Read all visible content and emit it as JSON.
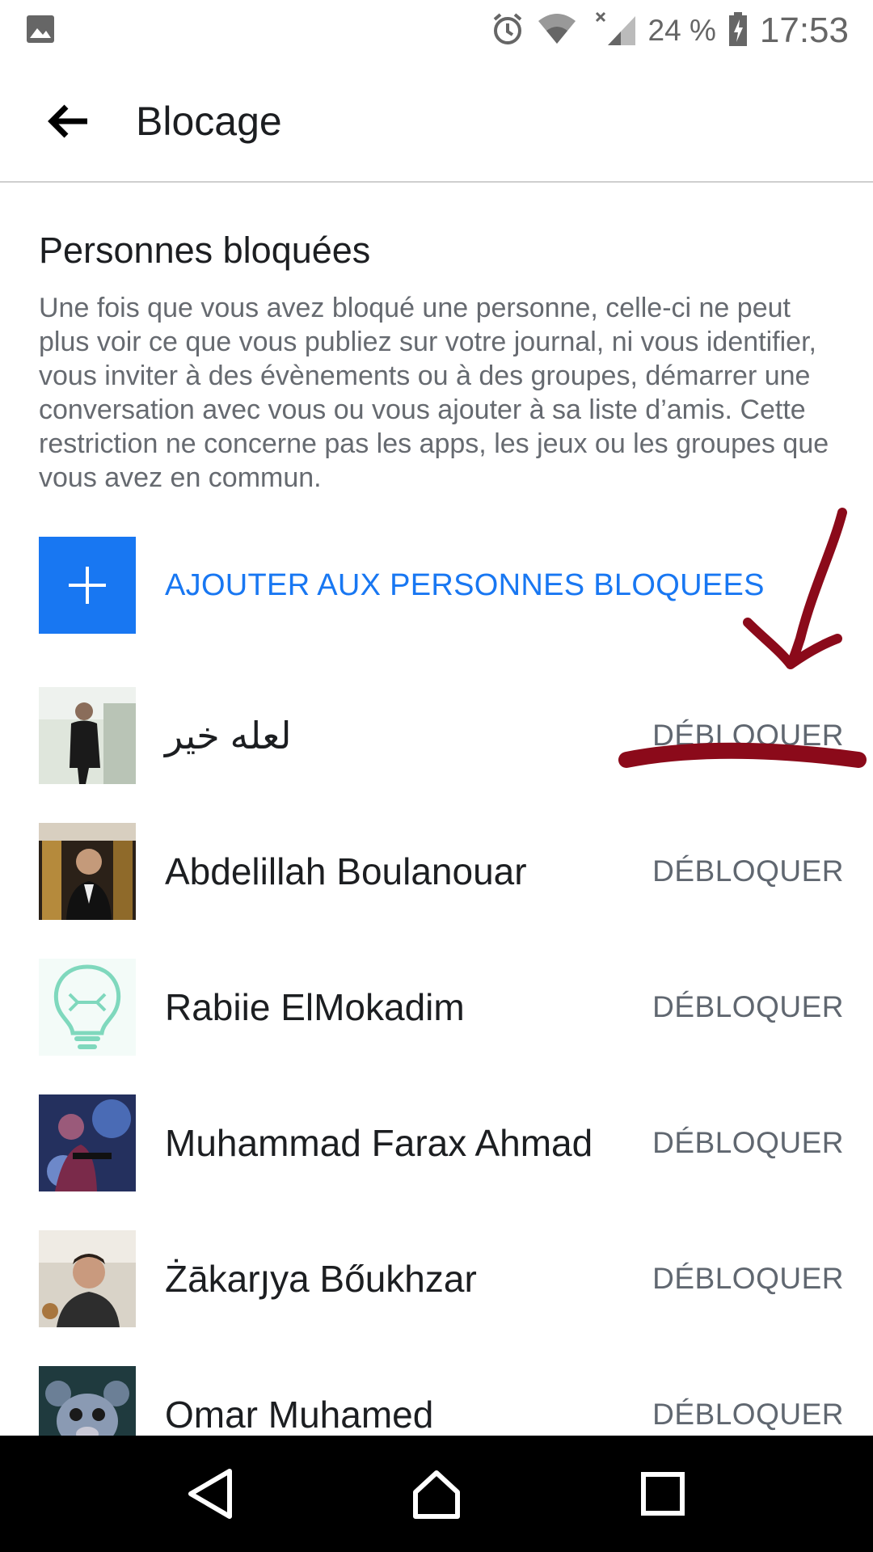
{
  "status_bar": {
    "battery_percent": "24 %",
    "time": "17:53",
    "icons": [
      "image-icon",
      "alarm-icon",
      "wifi-icon",
      "signal-icon",
      "battery-charging-icon"
    ]
  },
  "app_bar": {
    "title": "Blocage",
    "back_icon": "arrow-left-icon"
  },
  "section": {
    "title": "Personnes bloquées",
    "description": "Une fois que vous avez bloqué une personne, celle-ci ne peut plus voir ce que vous publiez sur votre journal, ni vous identifier, vous inviter à des évènements ou à des groupes, démarrer une conversation avec vous ou vous ajouter à sa liste d’amis. Cette restriction ne concerne pas les apps, les jeux ou les groupes que vous avez en commun."
  },
  "add_button": {
    "label": "AJOUTER AUX PERSONNES BLOQUEES",
    "icon": "plus-icon",
    "color": "#1877f2"
  },
  "blocked_people": [
    {
      "name": "لعله خير",
      "action": "DÉBLOQUER"
    },
    {
      "name": "Abdelillah Boulanouar",
      "action": "DÉBLOQUER"
    },
    {
      "name": "Rabiie ElMokadim",
      "action": "DÉBLOQUER"
    },
    {
      "name": "Muhammad Farax Ahmad",
      "action": "DÉBLOQUER"
    },
    {
      "name": "Żākarյya Bőukhzar",
      "action": "DÉBLOQUER"
    },
    {
      "name": "Omar Muhamed",
      "action": "DÉBLOQUER"
    }
  ],
  "annotation_color": "#8b0a1a",
  "nav_bar": {
    "icons": [
      "back-triangle-icon",
      "home-icon",
      "recents-icon"
    ]
  }
}
